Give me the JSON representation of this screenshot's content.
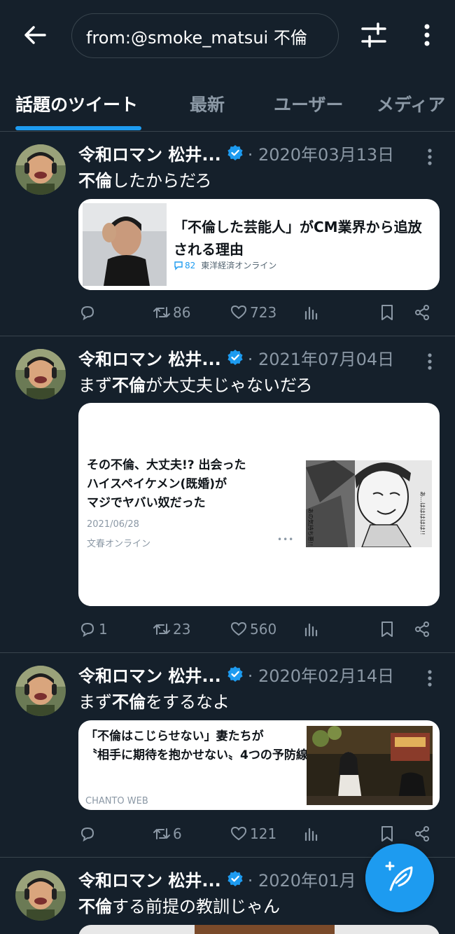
{
  "header": {
    "search_value": "from:@smoke_matsui 不倫",
    "back_icon": "arrow-left-icon",
    "filter_icon": "sliders-icon",
    "more_icon": "kebab-icon"
  },
  "tabs": [
    {
      "label": "話題のツイート"
    },
    {
      "label": "最新"
    },
    {
      "label": "ユーザー"
    },
    {
      "label": "メディア"
    }
  ],
  "tweets": [
    {
      "name": "令和ロマン 松井...",
      "date": "· 2020年03月13日",
      "text_pre": "",
      "text_bold": "不倫",
      "text_post": "したからだろ",
      "card": {
        "title": "「不倫した芸能人」がCM業界から追放される理由",
        "comments": "82",
        "source": "東洋経済オンライン"
      },
      "reply_count": "",
      "retweet_count": "86",
      "like_count": "723"
    },
    {
      "name": "令和ロマン 松井...",
      "date": "· 2021年07月04日",
      "text_pre": "まず",
      "text_bold": "不倫",
      "text_post": "が大丈夫じゃないだろ",
      "card": {
        "title_line1": "その不倫、大丈夫!? 出会った",
        "title_line2": "ハイスペイケメン(既婚)が",
        "title_line3": "マジでヤバい奴だった",
        "date": "2021/06/28",
        "source": "文春オンライン",
        "dots": "•••",
        "manga_caption_1": "あ…ははははは!!",
        "manga_caption_2": "あの気持ち悪!!"
      },
      "reply_count": "1",
      "retweet_count": "23",
      "like_count": "560"
    },
    {
      "name": "令和ロマン 松井...",
      "date": "· 2020年02月14日",
      "text_pre": "まず",
      "text_bold": "不倫",
      "text_post": "をするなよ",
      "card": {
        "title_line1": "「不倫はこじらせない」妻たちが",
        "title_line2": "〝相手に期待を抱かせない〟4つの予防線",
        "source": "CHANTO WEB"
      },
      "reply_count": "",
      "retweet_count": "6",
      "like_count": "121"
    },
    {
      "name": "令和ロマン 松井...",
      "date": "· 2020年01月",
      "text_pre": "",
      "text_bold": "不倫",
      "text_post": "する前提の教訓じゃん"
    }
  ],
  "fab": {
    "icon": "compose-feather-icon"
  },
  "colors": {
    "background": "#15202b",
    "accent": "#1d9bf0",
    "muted": "#8b98a5",
    "divider": "#38444d"
  }
}
